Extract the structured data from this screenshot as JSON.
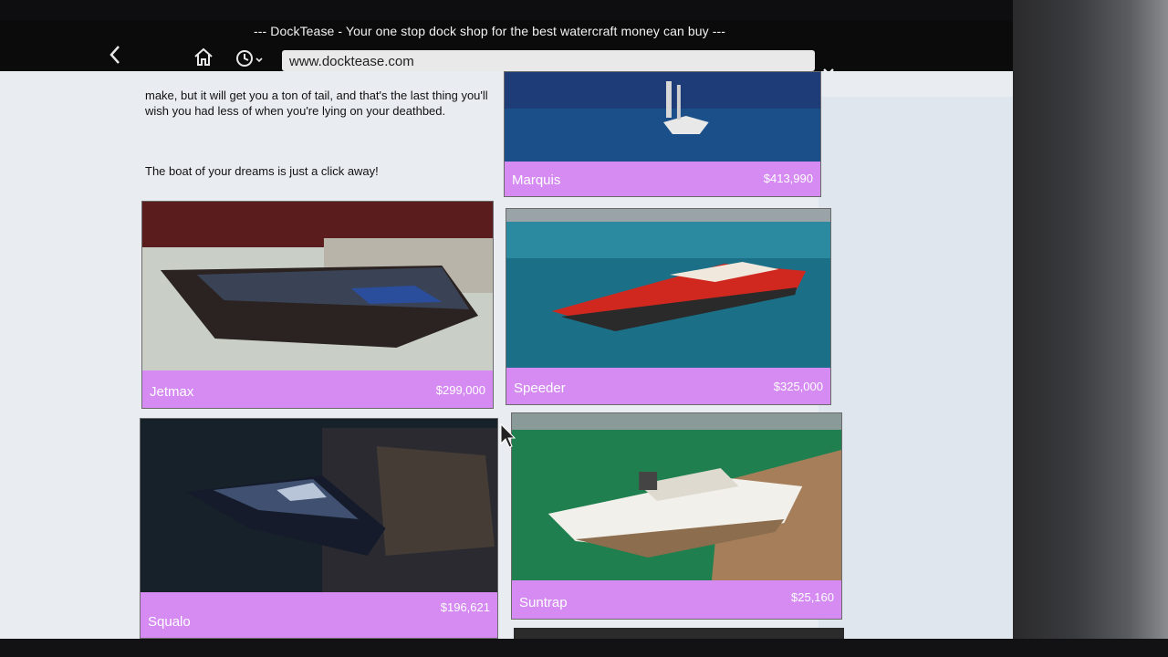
{
  "window": {
    "title": "--- DockTease - Your one stop dock shop for the best watercraft money can buy ---"
  },
  "toolbar": {
    "back_icon": "chevron-left-icon",
    "home_icon": "home-icon",
    "history_icon": "clock-icon",
    "url": "www.docktease.com",
    "close_icon": "close-icon"
  },
  "content": {
    "intro_text": "make, but it will get you a ton of tail, and that's the last thing you'll wish you had less of when you're lying on your deathbed.",
    "tagline": "The boat of your dreams is just a click away!"
  },
  "boats": [
    {
      "name": "Marquis",
      "price": "$413,990"
    },
    {
      "name": "Jetmax",
      "price": "$299,000"
    },
    {
      "name": "Speeder",
      "price": "$325,000"
    },
    {
      "name": "Squalo",
      "price": "$196,621"
    },
    {
      "name": "Suntrap",
      "price": "$25,160"
    }
  ],
  "colors": {
    "card_bar": "#d58bf1",
    "page_bg": "#e9edf2",
    "titlebar": "#0b0b0c"
  }
}
